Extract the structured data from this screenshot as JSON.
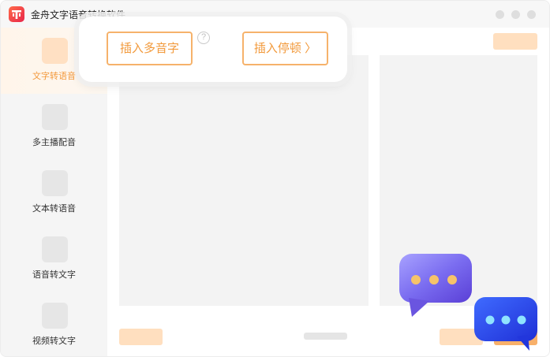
{
  "window": {
    "title": "金舟文字语音转换软件",
    "icon": "app-logo-icon"
  },
  "sidebar": {
    "items": [
      {
        "label": "文字转语音",
        "icon": "text-to-speech-icon",
        "active": true
      },
      {
        "label": "多主播配音",
        "icon": "multi-anchor-icon",
        "active": false
      },
      {
        "label": "文本转语音",
        "icon": "document-to-speech-icon",
        "active": false
      },
      {
        "label": "语音转文字",
        "icon": "speech-to-text-icon",
        "active": false
      },
      {
        "label": "视频转文字",
        "icon": "video-to-text-icon",
        "active": false
      }
    ]
  },
  "popup": {
    "insert_polyphone_label": "插入多音字",
    "insert_pause_label": "插入停顿 〉",
    "help_glyph": "?"
  },
  "colors": {
    "accent": "#f29a3c",
    "accent_light": "#ffdfbf",
    "active_nav_bg": "#fff5ea",
    "panel_bg": "#f3f3f3"
  }
}
